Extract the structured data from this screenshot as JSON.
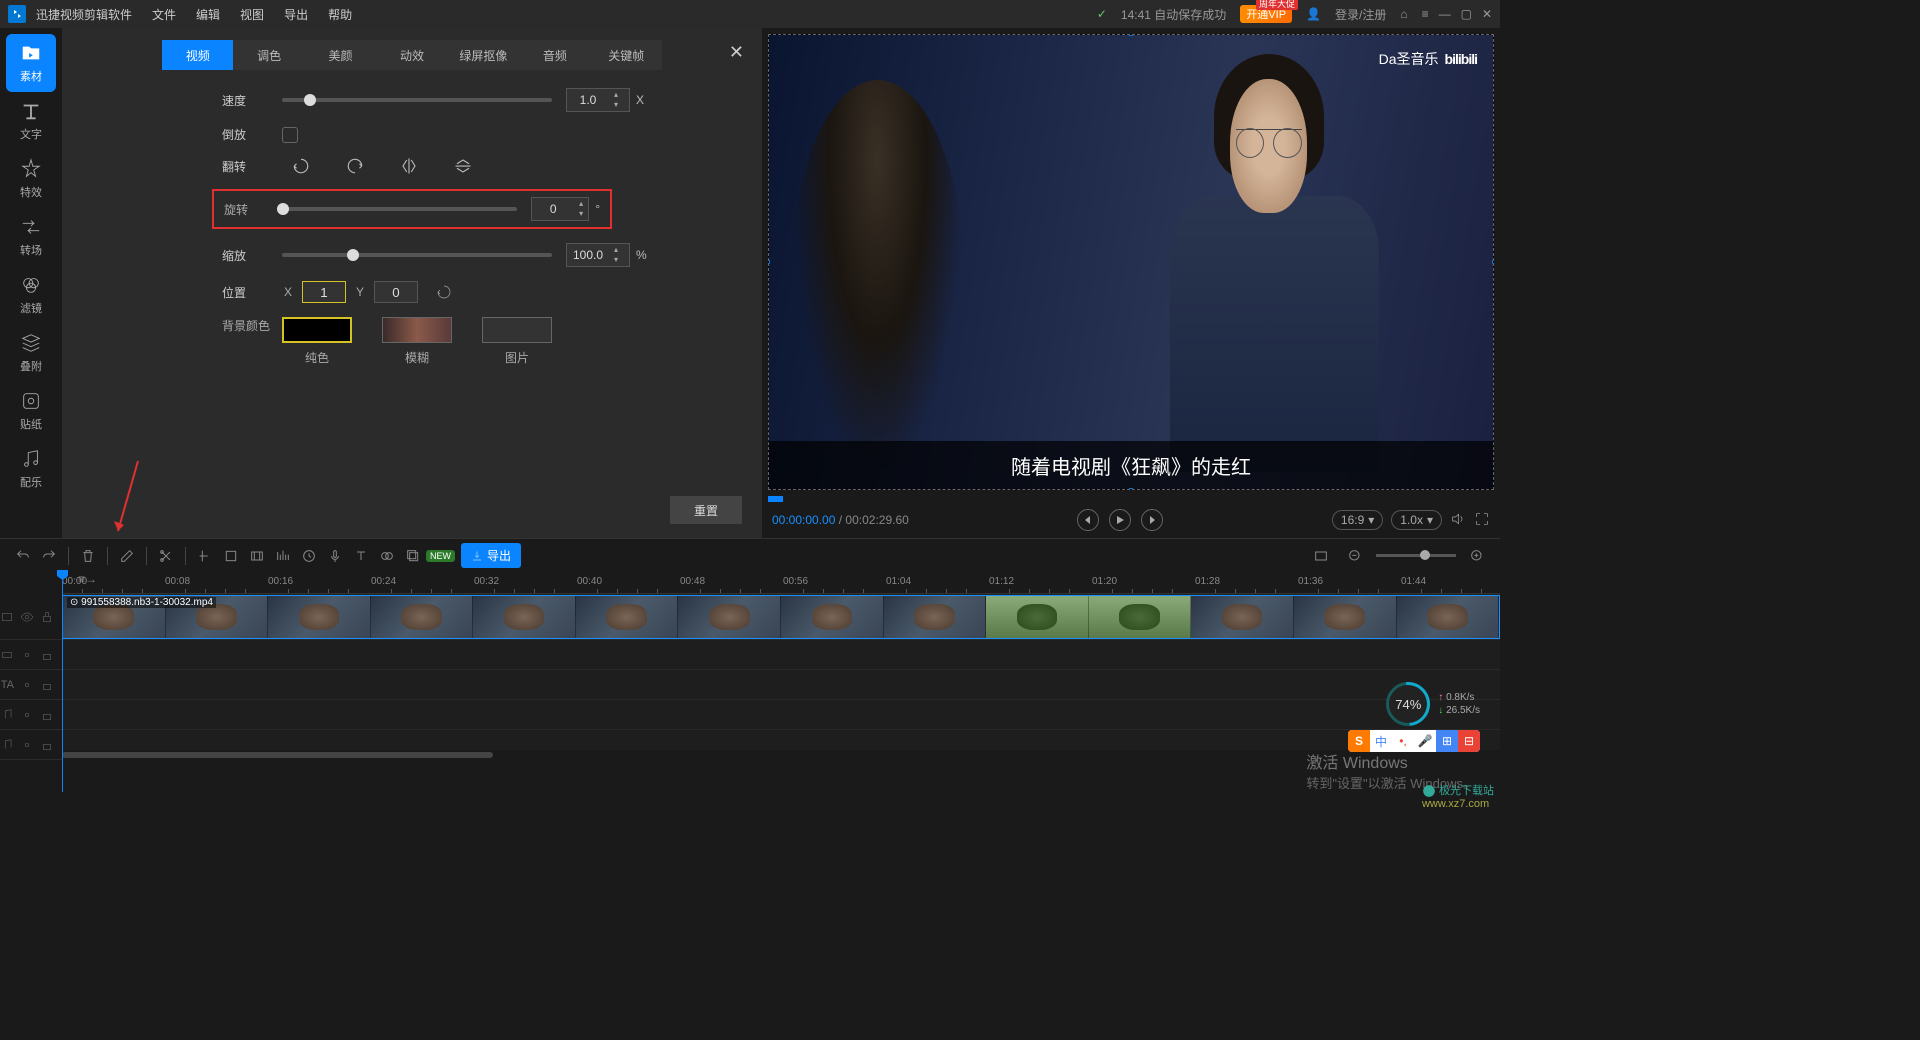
{
  "titlebar": {
    "app_name": "迅捷视频剪辑软件",
    "menus": [
      "文件",
      "编辑",
      "视图",
      "导出",
      "帮助"
    ],
    "autosave": "14:41 自动保存成功",
    "vip": "开通VIP",
    "vip_tag": "周年大促",
    "login": "登录/注册"
  },
  "sidebar": {
    "items": [
      {
        "label": "素材",
        "icon": "folder"
      },
      {
        "label": "文字",
        "icon": "text"
      },
      {
        "label": "特效",
        "icon": "star"
      },
      {
        "label": "转场",
        "icon": "transition"
      },
      {
        "label": "滤镜",
        "icon": "filter"
      },
      {
        "label": "叠附",
        "icon": "overlay"
      },
      {
        "label": "贴纸",
        "icon": "sticker"
      },
      {
        "label": "配乐",
        "icon": "music"
      }
    ]
  },
  "props": {
    "tabs": [
      "视频",
      "调色",
      "美颜",
      "动效",
      "绿屏抠像",
      "音频",
      "关键帧"
    ],
    "active_tab": 0,
    "speed": {
      "label": "速度",
      "value": "1.0",
      "unit": "X"
    },
    "reverse": {
      "label": "倒放"
    },
    "flip": {
      "label": "翻转"
    },
    "rotate": {
      "label": "旋转",
      "value": "0",
      "unit": "°"
    },
    "scale": {
      "label": "缩放",
      "value": "100.0",
      "unit": "%"
    },
    "position": {
      "label": "位置",
      "x": "1",
      "y": "0"
    },
    "bg": {
      "label": "背景颜色",
      "opts": [
        "纯色",
        "模糊",
        "图片"
      ]
    },
    "reset": "重置"
  },
  "preview": {
    "overlay_text": "Da圣音乐",
    "brand": "bilibili",
    "subtitle": "随着电视剧《狂飙》的走红",
    "time_current": "00:00:00.00",
    "time_total": "00:02:29.60",
    "aspect": "16:9",
    "rate": "1.0x"
  },
  "toolbar": {
    "new": "NEW",
    "export": "导出"
  },
  "timeline": {
    "ticks": [
      "00:00",
      "00:08",
      "00:16",
      "00:24",
      "00:32",
      "00:40",
      "00:48",
      "00:56",
      "01:04",
      "01:12",
      "01:20",
      "01:28",
      "01:36",
      "01:44"
    ],
    "clip_name": "991558388.nb3-1-30032.mp4"
  },
  "perf": {
    "pct": "74%",
    "up": "0.8K/s",
    "dn": "26.5K/s"
  },
  "activate": {
    "title": "激活 Windows",
    "sub": "转到\"设置\"以激活 Windows。"
  },
  "watermark": {
    "name": "极光下载站",
    "url": "www.xz7.com"
  }
}
